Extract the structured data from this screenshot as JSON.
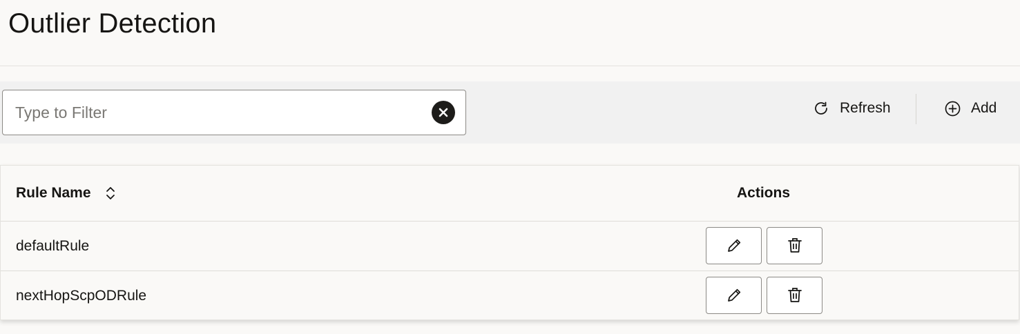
{
  "page": {
    "title": "Outlier Detection"
  },
  "toolbar": {
    "filter_placeholder": "Type to Filter",
    "filter_value": "",
    "clear_icon": "clear-circle-icon",
    "refresh_label": "Refresh",
    "refresh_icon": "refresh-icon",
    "add_label": "Add",
    "add_icon": "add-circle-icon"
  },
  "table": {
    "columns": [
      {
        "label": "Rule Name",
        "sortable": true
      },
      {
        "label": "Actions",
        "sortable": false
      }
    ],
    "rows": [
      {
        "rule_name": "defaultRule",
        "actions": [
          "edit-icon",
          "trash-icon"
        ]
      },
      {
        "rule_name": "nextHopScpODRule",
        "actions": [
          "edit-icon",
          "trash-icon"
        ]
      }
    ]
  },
  "colors": {
    "background": "#faf9f7",
    "toolbar_background": "#f1f1f1",
    "text": "#161513",
    "border": "#8b8985"
  }
}
